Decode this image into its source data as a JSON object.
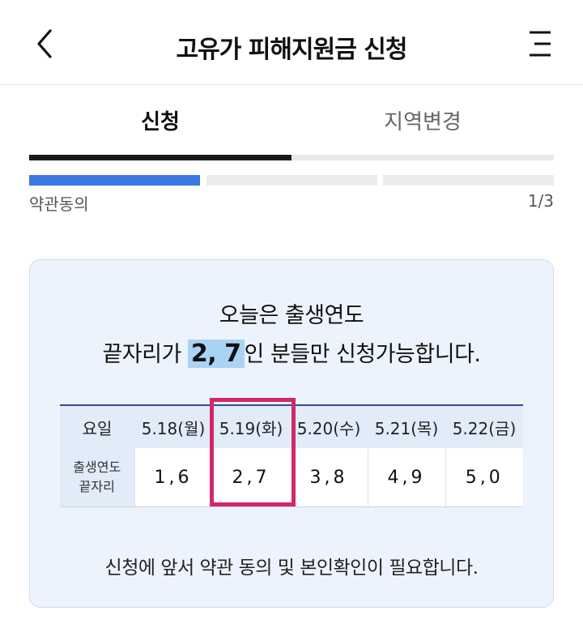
{
  "header": {
    "title": "고유가 피해지원금 신청",
    "back_icon": "chevron-left-icon",
    "menu_icon": "menu-icon"
  },
  "tabs": [
    {
      "label": "신청",
      "active": true
    },
    {
      "label": "지역변경",
      "active": false
    }
  ],
  "progress": {
    "label": "약관동의",
    "count": "1/3",
    "current": 1,
    "total": 3
  },
  "notice": {
    "line1": "오늘은 출생연도",
    "line2_pre": "끝자리가 ",
    "line2_highlight": "2, 7",
    "line2_post": "인 분들만 신청가능합니다."
  },
  "schedule": {
    "head_label": "요일",
    "row_label_1": "출생연도",
    "row_label_2": "끝자리",
    "days": [
      "5.18(월)",
      "5.19(화)",
      "5.20(수)",
      "5.21(목)",
      "5.22(금)"
    ],
    "digits": [
      "1,6",
      "2,7",
      "3,8",
      "4,9",
      "5,0"
    ],
    "selected_index": 1
  },
  "footnote": "신청에 앞서 약관 동의 및 본인확인이 필요합니다.",
  "colors": {
    "accent": "#3b78e0",
    "highlight": "#a9d3f5",
    "select_border": "#d0286a",
    "card_bg": "#edf3fc"
  }
}
